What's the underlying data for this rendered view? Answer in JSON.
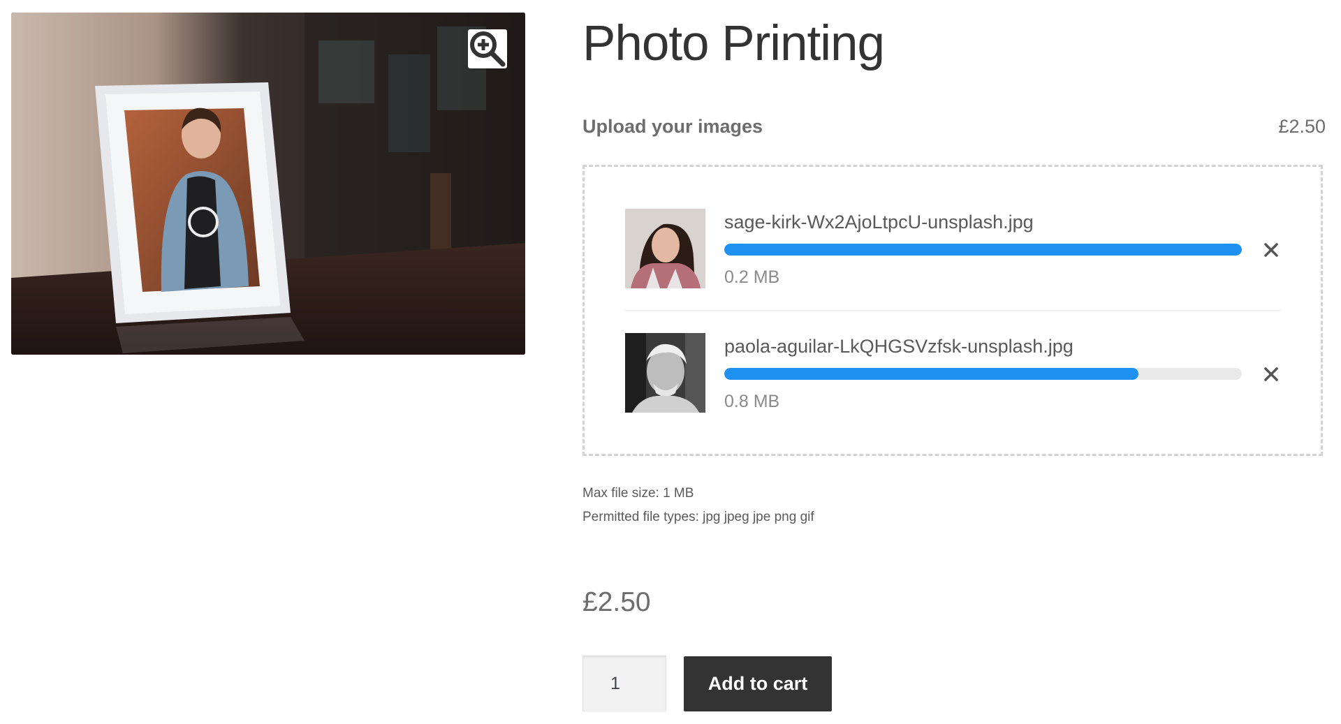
{
  "product": {
    "title": "Photo Printing",
    "price": "£2.50"
  },
  "gallery": {
    "zoom_icon": "zoom-in-icon"
  },
  "upload": {
    "label": "Upload your images",
    "price": "£2.50",
    "files": [
      {
        "name": "sage-kirk-Wx2AjoLtpcU-unsplash.jpg",
        "size": "0.2 MB",
        "progress_percent": 100
      },
      {
        "name": "paola-aguilar-LkQHGSVzfsk-unsplash.jpg",
        "size": "0.8 MB",
        "progress_percent": 80
      }
    ],
    "remove_icon": "close-icon",
    "max_file_size": "Max file size: 1 MB",
    "permitted_types": "Permitted file types: jpg jpeg jpe png gif"
  },
  "cart": {
    "quantity": "1",
    "add_to_cart_label": "Add to cart"
  },
  "colors": {
    "progress": "#1e90f0",
    "button": "#333333",
    "track": "#e9e9e9"
  }
}
